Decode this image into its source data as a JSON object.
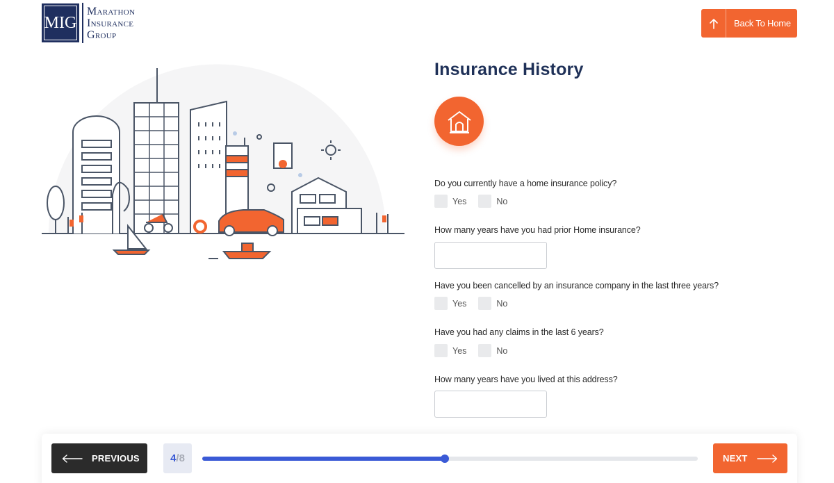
{
  "logo": {
    "mark": "MIG",
    "line1": "Marathon",
    "line2": "Insurance",
    "line3": "Group"
  },
  "header": {
    "back_label": "Back To Home"
  },
  "form": {
    "title": "Insurance History",
    "section_icon": "home-icon",
    "questions": [
      {
        "label": "Do you currently have a home insurance policy?",
        "type": "radio",
        "options": [
          "Yes",
          "No"
        ]
      },
      {
        "label": "How many years have you had prior Home insurance?",
        "type": "text",
        "value": ""
      },
      {
        "label": "Have you been cancelled by an insurance company in the last three years?",
        "type": "radio",
        "options": [
          "Yes",
          "No"
        ]
      },
      {
        "label": "Have you had any claims in the last 6 years?",
        "type": "radio",
        "options": [
          "Yes",
          "No"
        ]
      },
      {
        "label": "How many years have you lived at this address?",
        "type": "text",
        "value": ""
      }
    ]
  },
  "footer": {
    "previous_label": "PREVIOUS",
    "next_label": "NEXT",
    "step_current": "4",
    "step_separator": "/",
    "step_total": "8",
    "progress": 0.49
  },
  "colors": {
    "accent": "#f26530",
    "primary": "#3a5ad6",
    "navy": "#1f3158",
    "dark_button": "#2b2b2b"
  }
}
